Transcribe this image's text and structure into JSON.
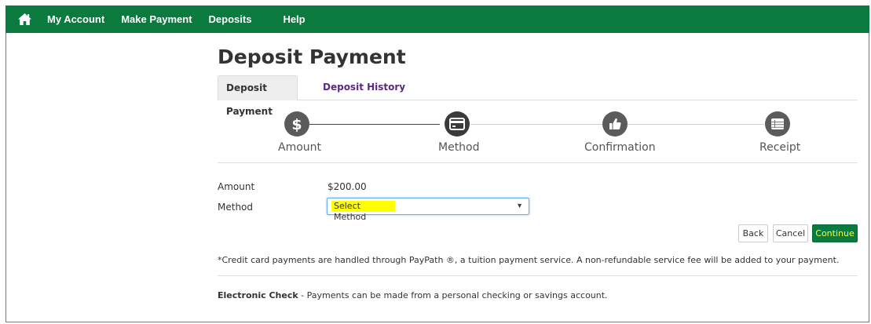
{
  "nav": {
    "home_icon": "home-icon",
    "items": [
      {
        "label": "My Account"
      },
      {
        "label": "Make Payment"
      },
      {
        "label": "Deposits"
      },
      {
        "label": "Help"
      }
    ]
  },
  "page": {
    "title": "Deposit Payment"
  },
  "tabs": [
    {
      "label": "Deposit Payment",
      "active": true
    },
    {
      "label": "Deposit History",
      "active": false
    }
  ],
  "steps": [
    {
      "label": "Amount",
      "icon": "dollar-icon"
    },
    {
      "label": "Method",
      "icon": "credit-card-icon",
      "current": true
    },
    {
      "label": "Confirmation",
      "icon": "thumbs-up-icon"
    },
    {
      "label": "Receipt",
      "icon": "list-icon"
    }
  ],
  "form": {
    "amount_label": "Amount",
    "amount_value": "$200.00",
    "method_label": "Method",
    "method_selected": "Select Method"
  },
  "buttons": {
    "back": "Back",
    "cancel": "Cancel",
    "continue": "Continue"
  },
  "notes": {
    "credit_card": "*Credit card payments are handled through PayPath ®, a tuition payment service. A non-refundable service fee will be added to your payment.",
    "echeck_title": "Electronic Check",
    "echeck_text": " - Payments can be made from a personal checking or savings  account."
  },
  "colors": {
    "brand_green": "#0b7a3e",
    "tab_link_purple": "#5a2a82",
    "highlight_yellow": "#ffff00"
  }
}
